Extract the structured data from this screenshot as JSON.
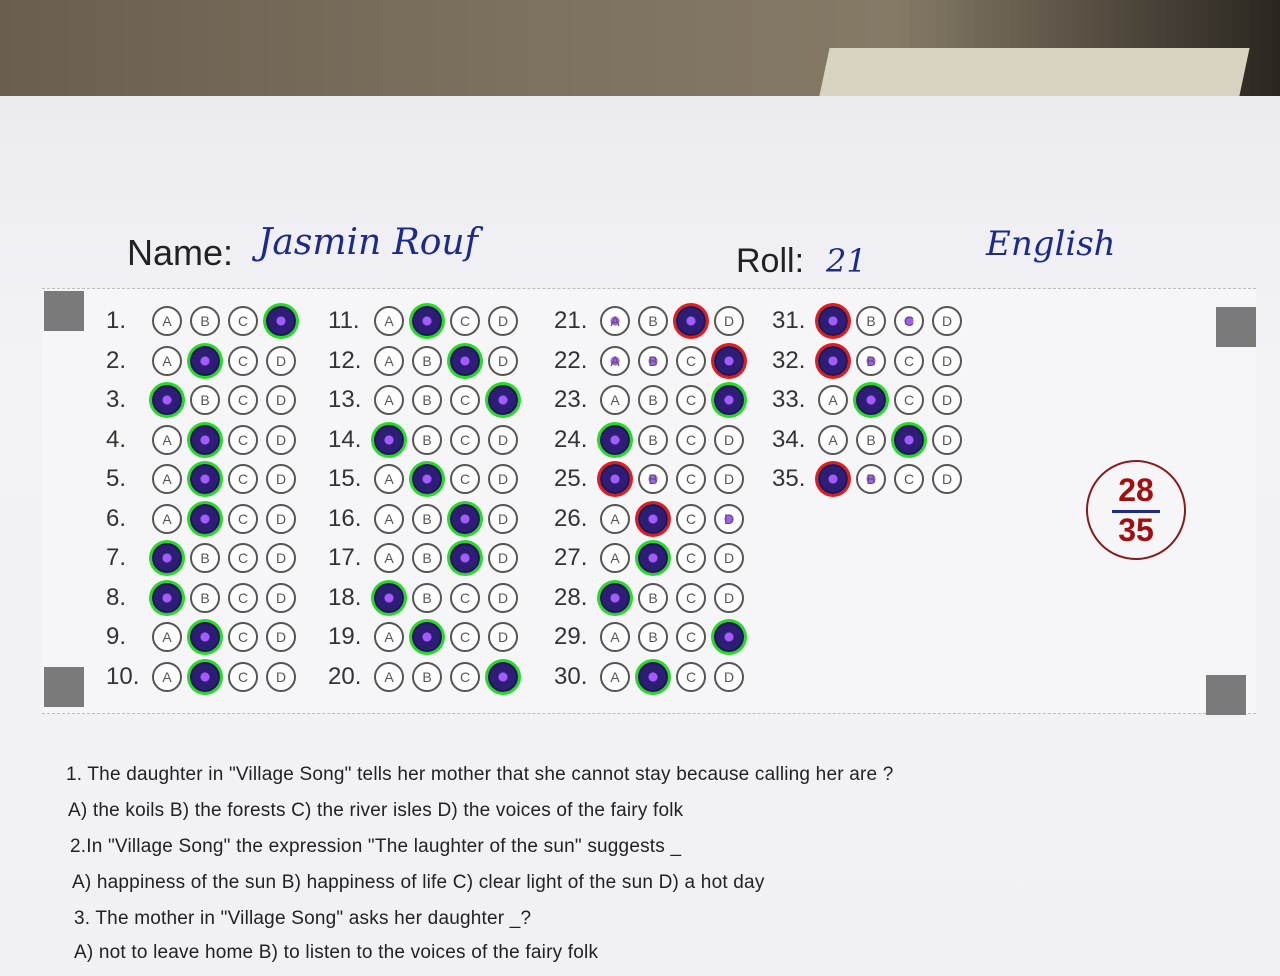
{
  "header": {
    "name_label": "Name:",
    "name_value": "Jasmin Rouf",
    "roll_label": "Roll:",
    "roll_value": "21",
    "subject": "English"
  },
  "score": {
    "obtained": "28",
    "total": "35"
  },
  "answers": [
    {
      "n": "1.",
      "marked": "D",
      "status": "correct"
    },
    {
      "n": "2.",
      "marked": "B",
      "status": "correct"
    },
    {
      "n": "3.",
      "marked": "A",
      "status": "correct"
    },
    {
      "n": "4.",
      "marked": "B",
      "status": "correct"
    },
    {
      "n": "5.",
      "marked": "B",
      "status": "correct"
    },
    {
      "n": "6.",
      "marked": "B",
      "status": "correct"
    },
    {
      "n": "7.",
      "marked": "A",
      "status": "correct"
    },
    {
      "n": "8.",
      "marked": "A",
      "status": "correct"
    },
    {
      "n": "9.",
      "marked": "B",
      "status": "correct"
    },
    {
      "n": "10.",
      "marked": "B",
      "status": "correct"
    },
    {
      "n": "11.",
      "marked": "B",
      "status": "correct"
    },
    {
      "n": "12.",
      "marked": "C",
      "status": "correct"
    },
    {
      "n": "13.",
      "marked": "D",
      "status": "correct"
    },
    {
      "n": "14.",
      "marked": "A",
      "status": "correct"
    },
    {
      "n": "15.",
      "marked": "B",
      "status": "correct"
    },
    {
      "n": "16.",
      "marked": "C",
      "status": "correct"
    },
    {
      "n": "17.",
      "marked": "C",
      "status": "correct"
    },
    {
      "n": "18.",
      "marked": "A",
      "status": "correct"
    },
    {
      "n": "19.",
      "marked": "B",
      "status": "correct"
    },
    {
      "n": "20.",
      "marked": "D",
      "status": "correct"
    },
    {
      "n": "21.",
      "marked": "C",
      "status": "wrong",
      "dots": [
        "A"
      ]
    },
    {
      "n": "22.",
      "marked": "D",
      "status": "wrong",
      "dots": [
        "A",
        "B"
      ]
    },
    {
      "n": "23.",
      "marked": "D",
      "status": "correct"
    },
    {
      "n": "24.",
      "marked": "A",
      "status": "correct"
    },
    {
      "n": "25.",
      "marked": "A",
      "status": "wrong",
      "dots": [
        "B"
      ]
    },
    {
      "n": "26.",
      "marked": "B",
      "status": "wrong",
      "dots": [
        "D"
      ]
    },
    {
      "n": "27.",
      "marked": "B",
      "status": "correct"
    },
    {
      "n": "28.",
      "marked": "A",
      "status": "correct"
    },
    {
      "n": "29.",
      "marked": "D",
      "status": "correct"
    },
    {
      "n": "30.",
      "marked": "B",
      "status": "correct"
    },
    {
      "n": "31.",
      "marked": "A",
      "status": "wrong",
      "dots": [
        "C"
      ]
    },
    {
      "n": "32.",
      "marked": "A",
      "status": "wrong",
      "dots": [
        "B"
      ]
    },
    {
      "n": "33.",
      "marked": "B",
      "status": "correct"
    },
    {
      "n": "34.",
      "marked": "C",
      "status": "correct"
    },
    {
      "n": "35.",
      "marked": "A",
      "status": "wrong",
      "dots": [
        "B"
      ]
    }
  ],
  "questions": [
    "1. The daughter in \"Village Song\" tells her mother that she cannot stay because calling her are ?",
    "A) the koils      B) the forests  C) the river isles      D) the voices of the fairy folk",
    "2.In \"Village Song\" the expression \"The laughter of the sun\" suggests _",
    "A) happiness of the sun     B) happiness of life   C) clear light of the sun       D) a hot day",
    "3. The mother in \"Village Song\" asks her daughter _?",
    "A) not to leave home        B) to listen to the voices of the fairy folk"
  ]
}
